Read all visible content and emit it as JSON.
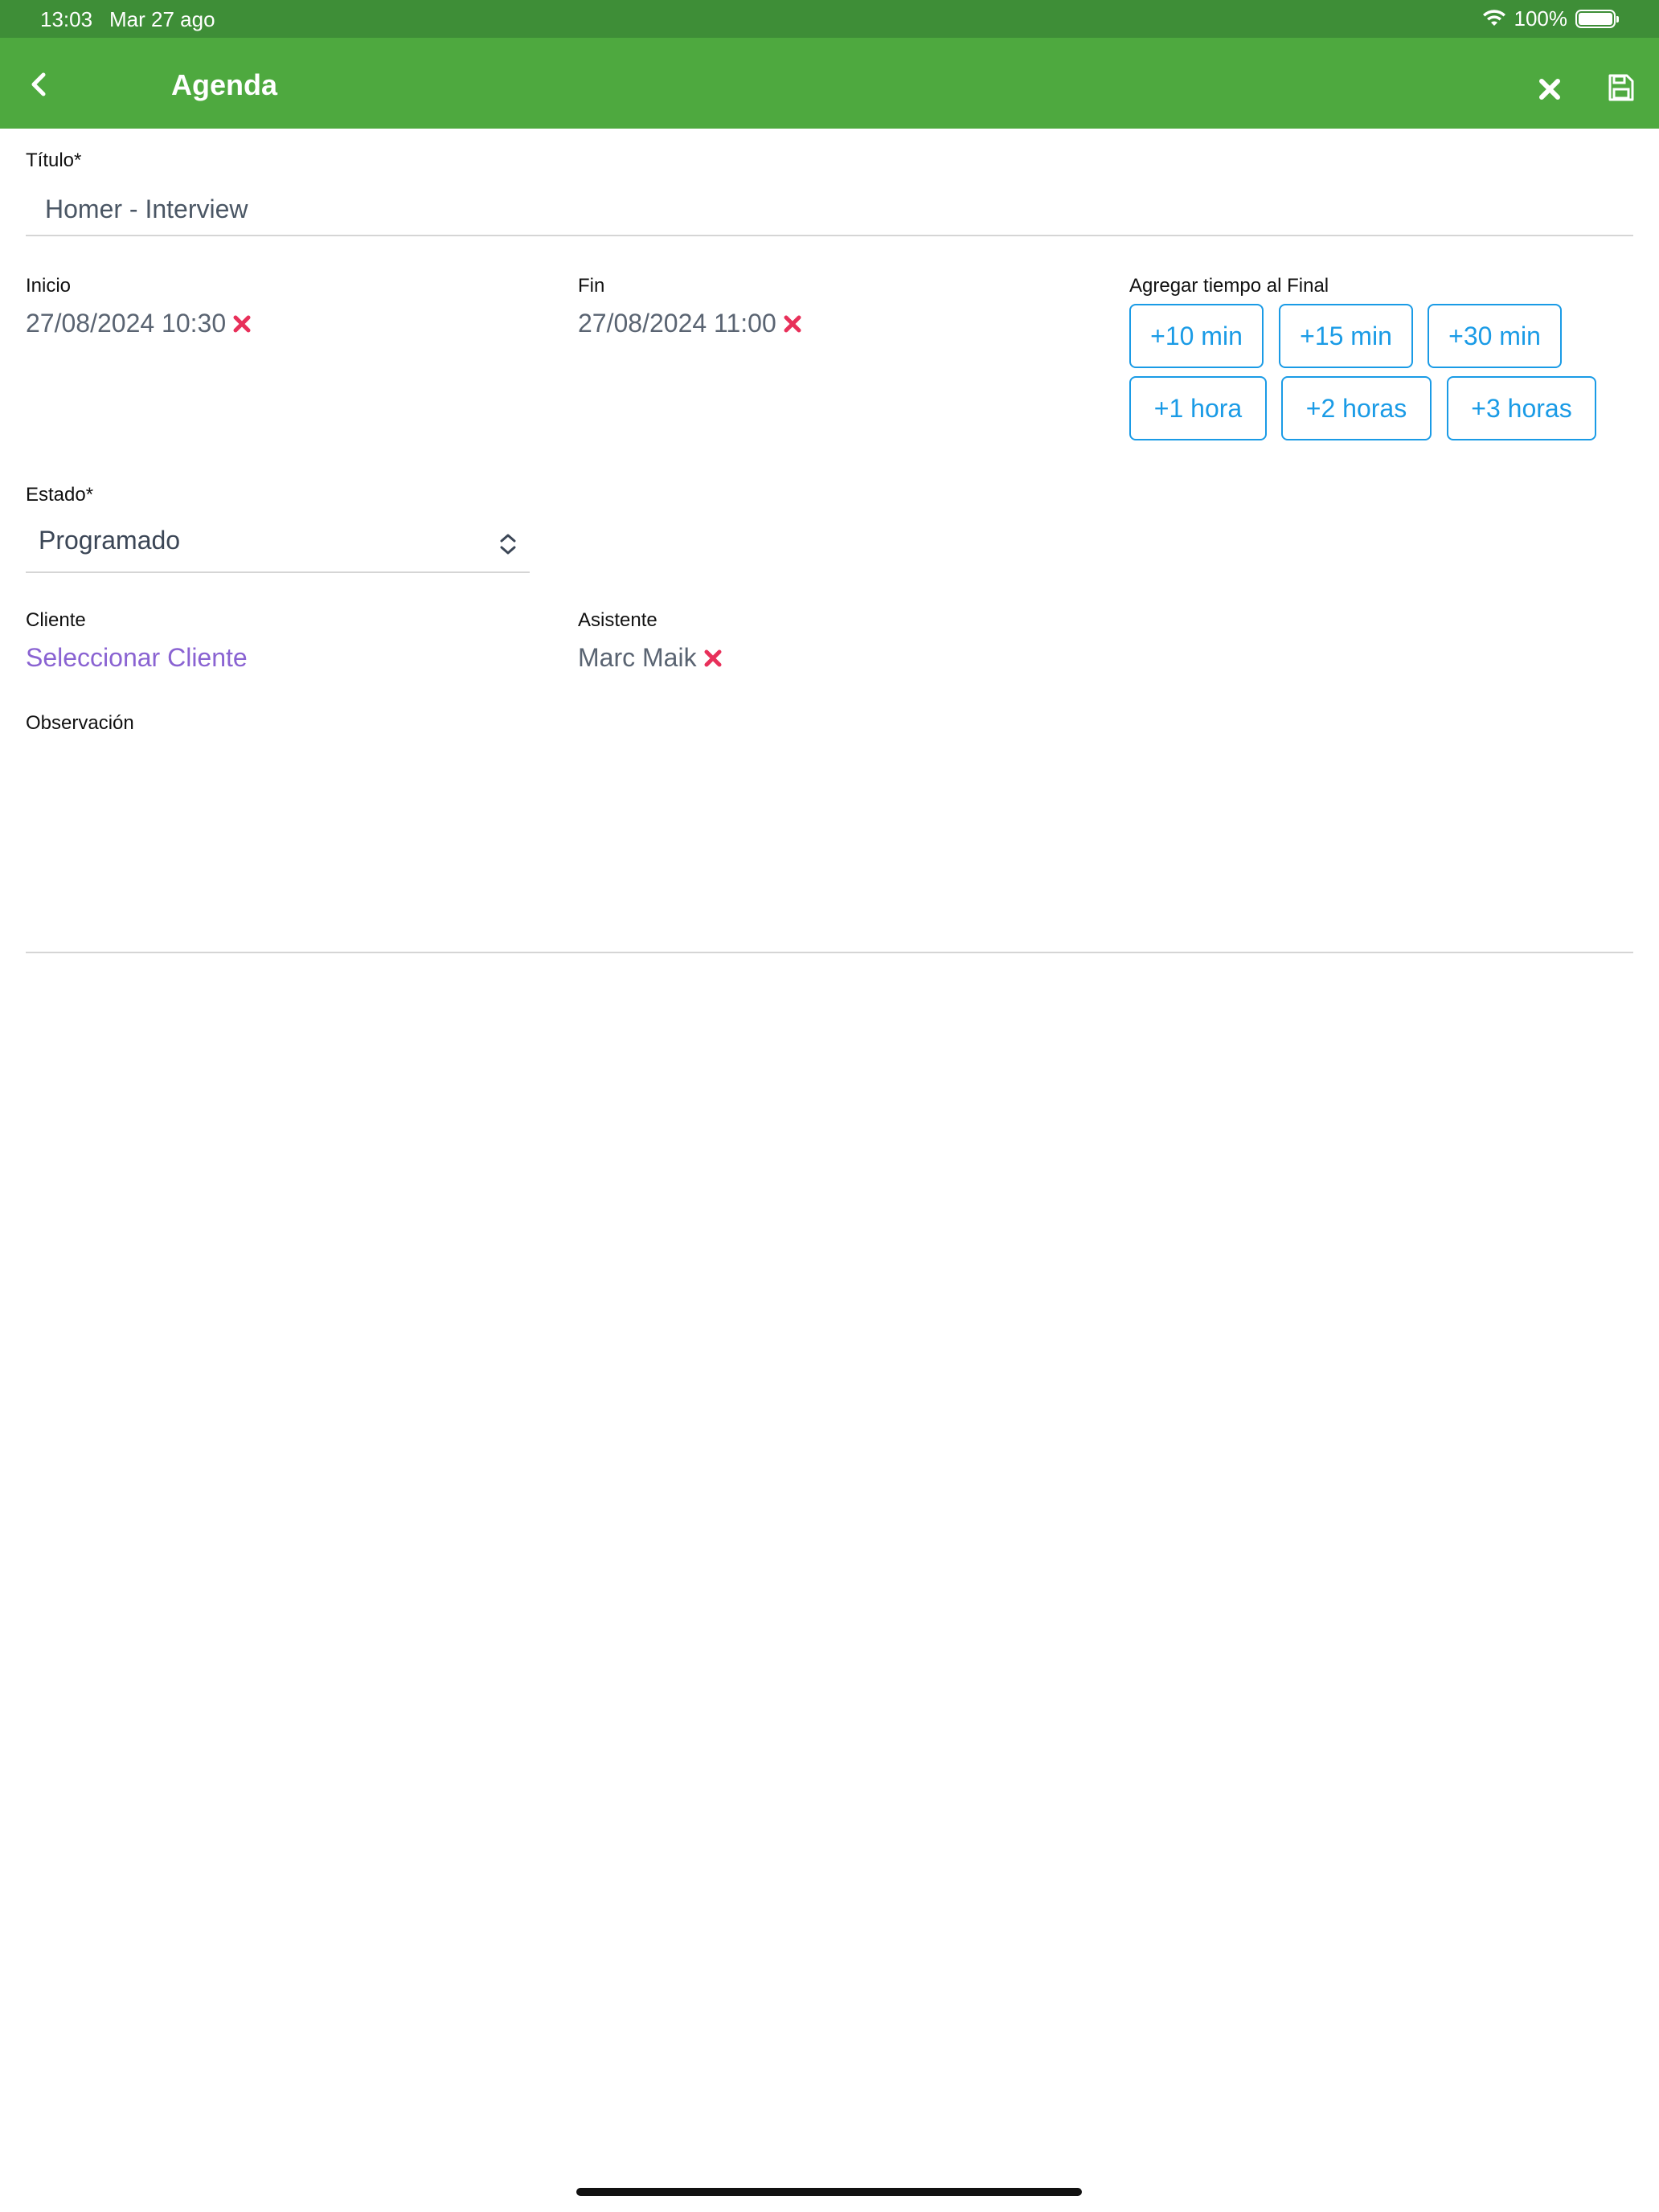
{
  "status_bar": {
    "time": "13:03",
    "date": "Mar 27 ago",
    "battery_text": "100%",
    "battery_level": 1.0
  },
  "navbar": {
    "title": "Agenda",
    "back_icon": "chevron-left-icon",
    "close_icon": "close-icon",
    "save_icon": "save-icon"
  },
  "form": {
    "title_label": "Título*",
    "title_value": "Homer - Interview",
    "start_label": "Inicio",
    "start_value": "27/08/2024 10:30",
    "end_label": "Fin",
    "end_value": "27/08/2024 11:00",
    "add_time_label": "Agregar tiempo al Final",
    "add_time_buttons": [
      "+10 min",
      "+15 min",
      "+30 min",
      "+1 hora",
      "+2 horas",
      "+3 horas"
    ],
    "status_label": "Estado*",
    "status_value": "Programado",
    "client_label": "Cliente",
    "client_link": "Seleccionar Cliente",
    "assistant_label": "Asistente",
    "assistant_value": "Marc Maik",
    "observation_label": "Observación",
    "observation_value": ""
  },
  "colors": {
    "status_bar": "#3e8e37",
    "navbar": "#4ea93f",
    "accent_blue": "#1a9be6",
    "link_purple": "#8a63d2",
    "clear_red": "#e8305a"
  }
}
